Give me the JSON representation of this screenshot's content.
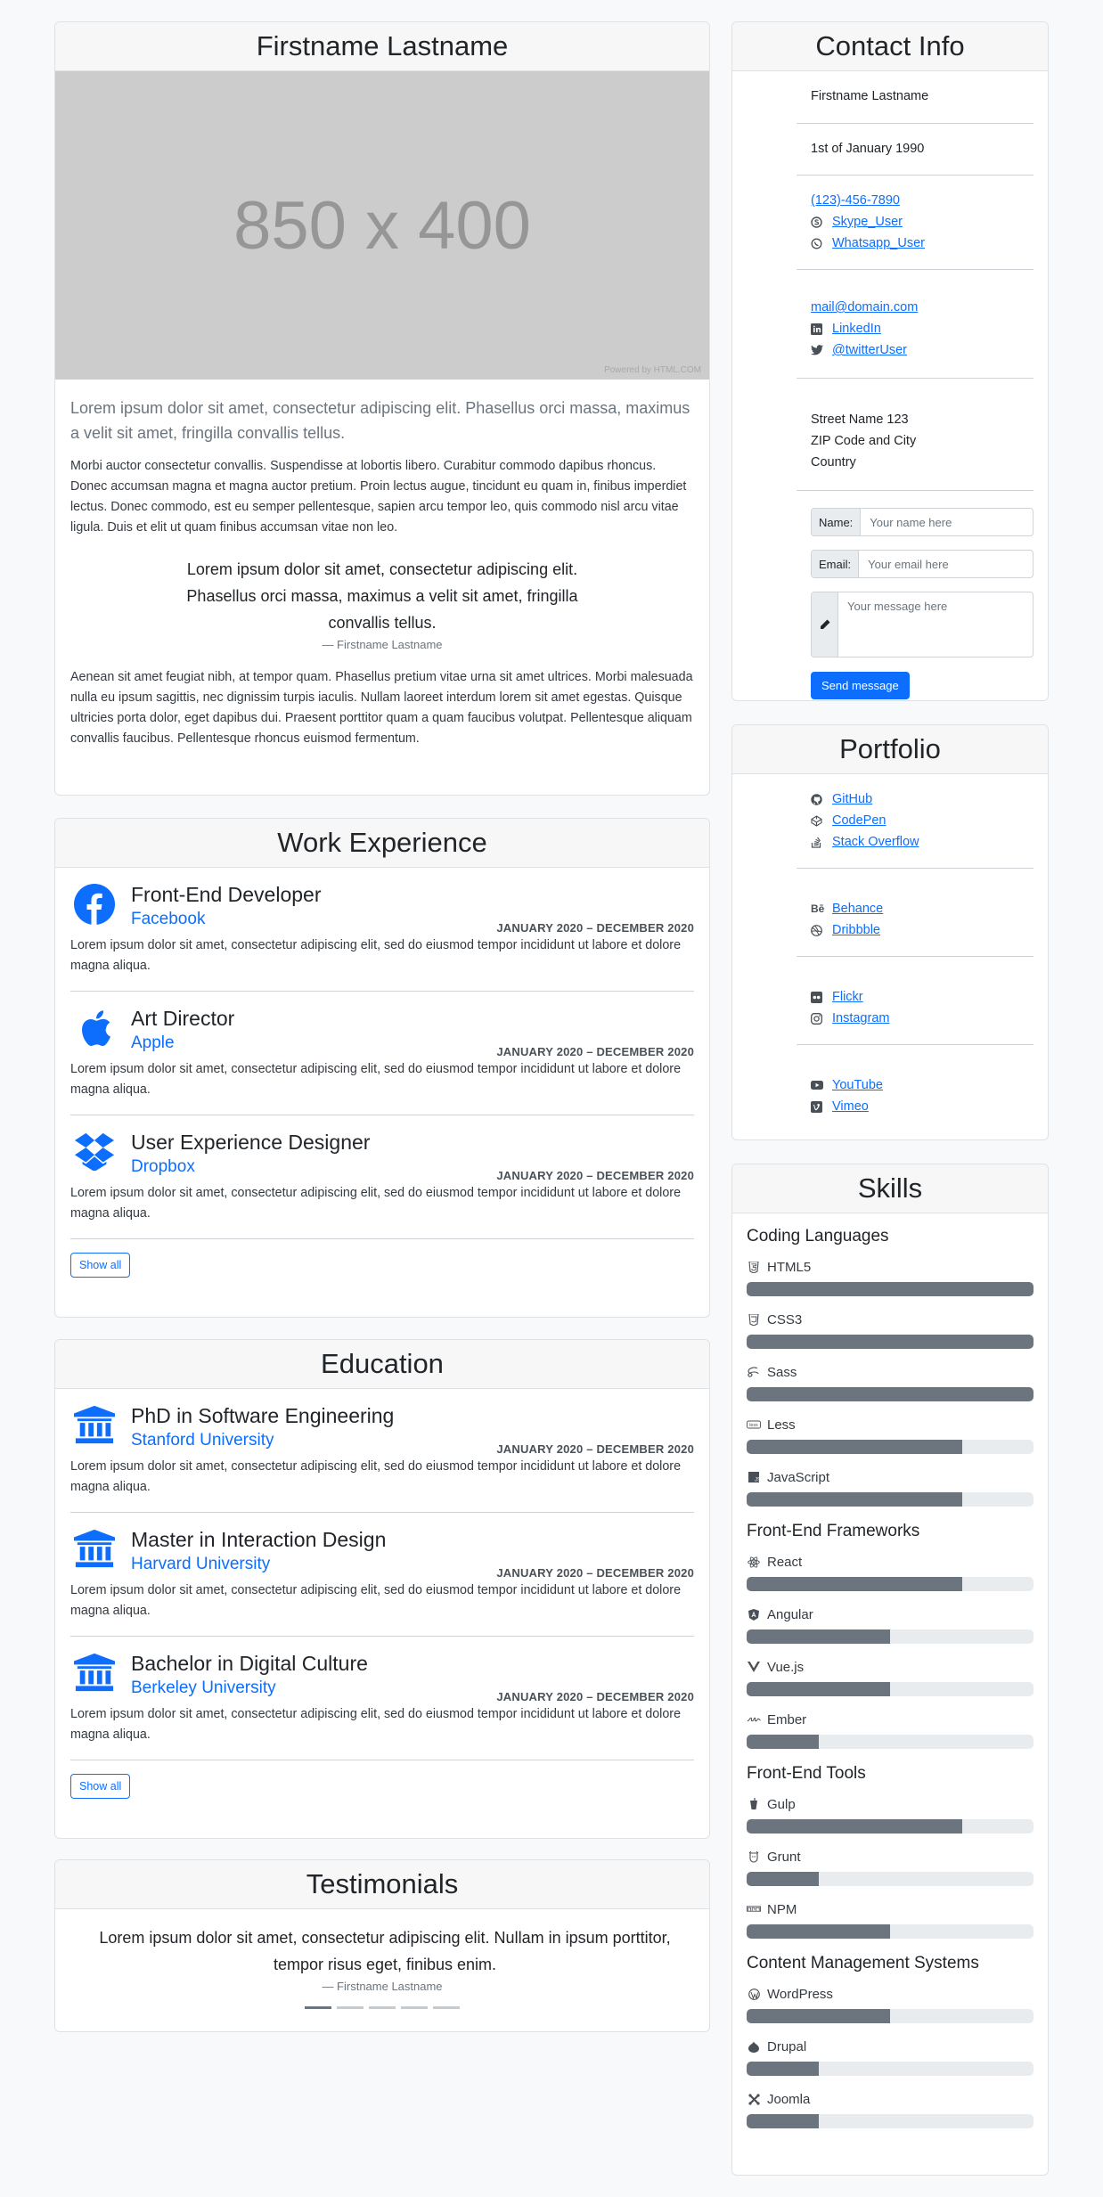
{
  "profile": {
    "name": "Firstname Lastname",
    "image_text": "850 x 400",
    "image_credit": "Powered by HTML.COM",
    "lead": "Lorem ipsum dolor sit amet, consectetur adipiscing elit. Phasellus orci massa, maximus a velit sit amet, fringilla convallis tellus.",
    "para1": "Morbi auctor consectetur convallis. Suspendisse at lobortis libero. Curabitur commodo dapibus rhoncus. Donec accumsan magna et magna auctor pretium. Proin lectus augue, tincidunt eu quam in, finibus imperdiet lectus. Donec commodo, est eu semper pellentesque, sapien arcu tempor leo, quis commodo nisl arcu vitae ligula. Duis et elit ut quam finibus accumsan vitae non leo.",
    "quote": "Lorem ipsum dolor sit amet, consectetur adipiscing elit. Phasellus orci massa, maximus a velit sit amet, fringilla convallis tellus.",
    "quote_author": "— Firstname Lastname",
    "para2": "Aenean sit amet feugiat nibh, at tempor quam. Phasellus pretium vitae urna sit amet ultrices. Morbi malesuada nulla eu ipsum sagittis, nec dignissim turpis iaculis. Nullam laoreet interdum lorem sit amet egestas. Quisque ultricies porta dolor, eget dapibus dui. Praesent porttitor quam a quam faucibus volutpat. Pellentesque aliquam convallis faucibus. Pellentesque rhoncus euismod fermentum."
  },
  "work": {
    "title": "Work Experience",
    "show_all": "Show all",
    "items": [
      {
        "title": "Front-End Developer",
        "org": "Facebook",
        "date": "JANUARY 2020 – DECEMBER 2020",
        "desc": "Lorem ipsum dolor sit amet, consectetur adipiscing elit, sed do eiusmod tempor incididunt ut labore et dolore magna aliqua.",
        "icon": "facebook-icon"
      },
      {
        "title": "Art Director",
        "org": "Apple",
        "date": "JANUARY 2020 – DECEMBER 2020",
        "desc": "Lorem ipsum dolor sit amet, consectetur adipiscing elit, sed do eiusmod tempor incididunt ut labore et dolore magna aliqua.",
        "icon": "apple-icon"
      },
      {
        "title": "User Experience Designer",
        "org": "Dropbox",
        "date": "JANUARY 2020 – DECEMBER 2020",
        "desc": "Lorem ipsum dolor sit amet, consectetur adipiscing elit, sed do eiusmod tempor incididunt ut labore et dolore magna aliqua.",
        "icon": "dropbox-icon"
      }
    ]
  },
  "education": {
    "title": "Education",
    "show_all": "Show all",
    "items": [
      {
        "title": "PhD in Software Engineering",
        "org": "Stanford University",
        "date": "JANUARY 2020 – DECEMBER 2020",
        "desc": "Lorem ipsum dolor sit amet, consectetur adipiscing elit, sed do eiusmod tempor incididunt ut labore et dolore magna aliqua.",
        "icon": "university-icon"
      },
      {
        "title": "Master in Interaction Design",
        "org": "Harvard University",
        "date": "JANUARY 2020 – DECEMBER 2020",
        "desc": "Lorem ipsum dolor sit amet, consectetur adipiscing elit, sed do eiusmod tempor incididunt ut labore et dolore magna aliqua.",
        "icon": "university-icon"
      },
      {
        "title": "Bachelor in Digital Culture",
        "org": "Berkeley University",
        "date": "JANUARY 2020 – DECEMBER 2020",
        "desc": "Lorem ipsum dolor sit amet, consectetur adipiscing elit, sed do eiusmod tempor incididunt ut labore et dolore magna aliqua.",
        "icon": "university-icon"
      }
    ]
  },
  "testimonials": {
    "title": "Testimonials",
    "quote": "Lorem ipsum dolor sit amet, consectetur adipiscing elit. Nullam in ipsum porttitor, tempor risus eget, finibus enim.",
    "author": "— Firstname Lastname",
    "slide_count": 5,
    "active_slide": 1
  },
  "contact": {
    "title": "Contact Info",
    "name": "Firstname Lastname",
    "birthday": "1st of January 1990",
    "phone": "(123)-456-7890",
    "skype": "Skype_User",
    "whatsapp": "Whatsapp_User",
    "email": "mail@domain.com",
    "linkedin": "LinkedIn",
    "twitter": "@twitterUser",
    "address1": "Street Name 123",
    "address2": "ZIP Code and City",
    "address3": "Country",
    "form": {
      "name_label": "Name:",
      "name_placeholder": "Your name here",
      "email_label": "Email:",
      "email_placeholder": "Your email here",
      "message_placeholder": "Your message here",
      "send": "Send message"
    }
  },
  "portfolio": {
    "title": "Portfolio",
    "code": [
      "GitHub",
      "CodePen",
      "Stack Overflow"
    ],
    "design": [
      "Behance",
      "Dribbble"
    ],
    "photo": [
      "Flickr",
      "Instagram"
    ],
    "video": [
      "YouTube",
      "Vimeo"
    ]
  },
  "skills": {
    "title": "Skills",
    "groups": [
      {
        "title": "Coding Languages",
        "items": [
          {
            "name": "HTML5",
            "level": 1.0,
            "icon": "html5-icon"
          },
          {
            "name": "CSS3",
            "level": 1.0,
            "icon": "css3-icon"
          },
          {
            "name": "Sass",
            "level": 1.0,
            "icon": "sass-icon"
          },
          {
            "name": "Less",
            "level": 0.75,
            "icon": "less-icon"
          },
          {
            "name": "JavaScript",
            "level": 0.75,
            "icon": "js-icon"
          }
        ]
      },
      {
        "title": "Front-End Frameworks",
        "items": [
          {
            "name": "React",
            "level": 0.75,
            "icon": "react-icon"
          },
          {
            "name": "Angular",
            "level": 0.5,
            "icon": "angular-icon"
          },
          {
            "name": "Vue.js",
            "level": 0.5,
            "icon": "vue-icon"
          },
          {
            "name": "Ember",
            "level": 0.25,
            "icon": "ember-icon"
          }
        ]
      },
      {
        "title": "Front-End Tools",
        "items": [
          {
            "name": "Gulp",
            "level": 0.75,
            "icon": "gulp-icon"
          },
          {
            "name": "Grunt",
            "level": 0.25,
            "icon": "grunt-icon"
          },
          {
            "name": "NPM",
            "level": 0.5,
            "icon": "npm-icon"
          }
        ]
      },
      {
        "title": "Content Management Systems",
        "items": [
          {
            "name": "WordPress",
            "level": 0.5,
            "icon": "wordpress-icon"
          },
          {
            "name": "Drupal",
            "level": 0.25,
            "icon": "drupal-icon"
          },
          {
            "name": "Joomla",
            "level": 0.25,
            "icon": "joomla-icon"
          }
        ]
      }
    ]
  },
  "colors": {
    "accent": "#0d6efd",
    "bar": "#6c757d",
    "track": "#e9ecef"
  }
}
